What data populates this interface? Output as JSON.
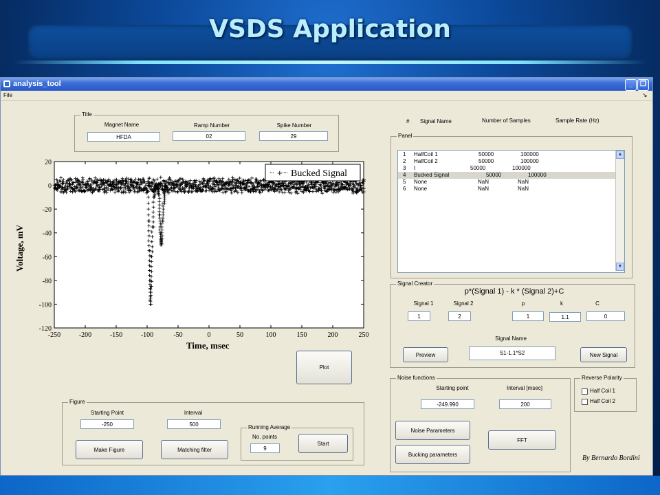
{
  "slide": {
    "title": "VSDS Application",
    "author": "By Bernardo Bordini"
  },
  "window": {
    "title": "analysis_tool",
    "menu": [
      "File"
    ],
    "menu_arrow": "↘"
  },
  "title_panel": {
    "legend": "Title",
    "magnet_name_label": "Magnet Name",
    "magnet_name_value": "HFDA",
    "ramp_number_label": "Ramp Number",
    "ramp_number_value": "02",
    "spike_number_label": "Spike Number",
    "spike_number_value": "29"
  },
  "signal_table": {
    "headers": [
      "#",
      "Signal Name",
      "Number of Samples",
      "Sample Rate (Hz)"
    ],
    "panel_legend": "Panel",
    "rows": [
      {
        "num": "1",
        "name": "HalfCoil 1",
        "samples": "50000",
        "rate": "100000"
      },
      {
        "num": "2",
        "name": "HalfCoil 2",
        "samples": "50000",
        "rate": "100000"
      },
      {
        "num": "3",
        "name": "I",
        "samples": "50000",
        "rate": "100000"
      },
      {
        "num": "4",
        "name": "Bucked Signal",
        "samples": "50000",
        "rate": "100000"
      },
      {
        "num": "5",
        "name": "None",
        "samples": "NaN",
        "rate": "NaN"
      },
      {
        "num": "6",
        "name": "None",
        "samples": "NaN",
        "rate": "NaN"
      }
    ],
    "selected_index": 3
  },
  "signal_creator": {
    "legend": "Signal Creator",
    "formula": "p*(Signal 1) - k * (Signal 2)+C",
    "signal1_label": "Signal 1",
    "signal1_value": "1",
    "signal2_label": "Signal 2",
    "signal2_value": "2",
    "p_label": "p",
    "p_value": "1",
    "k_label": "k",
    "k_value": "1.1",
    "c_label": "C",
    "c_value": "0",
    "signal_name_label": "Signal Name",
    "signal_name_value": "S1-1.1*S2",
    "preview_label": "Preview",
    "new_signal_label": "New Signal"
  },
  "plot_button": "Plot",
  "figure_panel": {
    "legend": "Figure",
    "starting_point_label": "Starting Point",
    "starting_point_value": "-250",
    "interval_label": "Interval",
    "interval_value": "500",
    "make_figure_label": "Make Figure",
    "matching_filter_label": "Matching filter",
    "running_average": {
      "legend": "Running Average",
      "points_label": "No. points",
      "points_value": "9",
      "start_label": "Start"
    }
  },
  "noise_panel": {
    "legend": "Noise functions",
    "starting_point_label": "Starting point",
    "starting_point_value": "-249.990",
    "interval_label": "Interval [msec]",
    "interval_value": "200",
    "noise_params_label": "Noise Parameters",
    "bucking_params_label": "Bucking parameters",
    "fft_label": "FFT"
  },
  "reverse_polarity": {
    "legend": "Reverse Polarity",
    "options": [
      {
        "label": "Half Coil 1",
        "checked": false
      },
      {
        "label": "Half Coil 2",
        "checked": false
      }
    ]
  },
  "chart_data": {
    "type": "scatter",
    "xlabel": "Time, msec",
    "ylabel": "Voltage, mV",
    "xlim": [
      -250,
      250
    ],
    "ylim": [
      -120,
      20
    ],
    "xticks": [
      -250,
      -200,
      -150,
      -100,
      -50,
      0,
      50,
      100,
      150,
      200,
      250
    ],
    "yticks": [
      20,
      0,
      -20,
      -40,
      -60,
      -80,
      -100,
      -120
    ],
    "grid": false,
    "legend_position": "top-right",
    "marker": "+",
    "series": [
      {
        "name": "Bucked Signal",
        "baseline_band": [
          -5,
          5
        ],
        "x": [
          -98,
          -97,
          -96,
          -95,
          -94,
          -93,
          -92,
          -90,
          -88,
          -86,
          -84,
          -82,
          -80,
          -79,
          -78,
          -77,
          -76,
          -74,
          -72,
          -70
        ],
        "y": [
          -30,
          -55,
          -80,
          -100,
          -85,
          -60,
          -35,
          -10,
          -3,
          0,
          -2,
          -8,
          -25,
          -40,
          -50,
          -45,
          -30,
          -15,
          -5,
          0
        ]
      }
    ]
  }
}
